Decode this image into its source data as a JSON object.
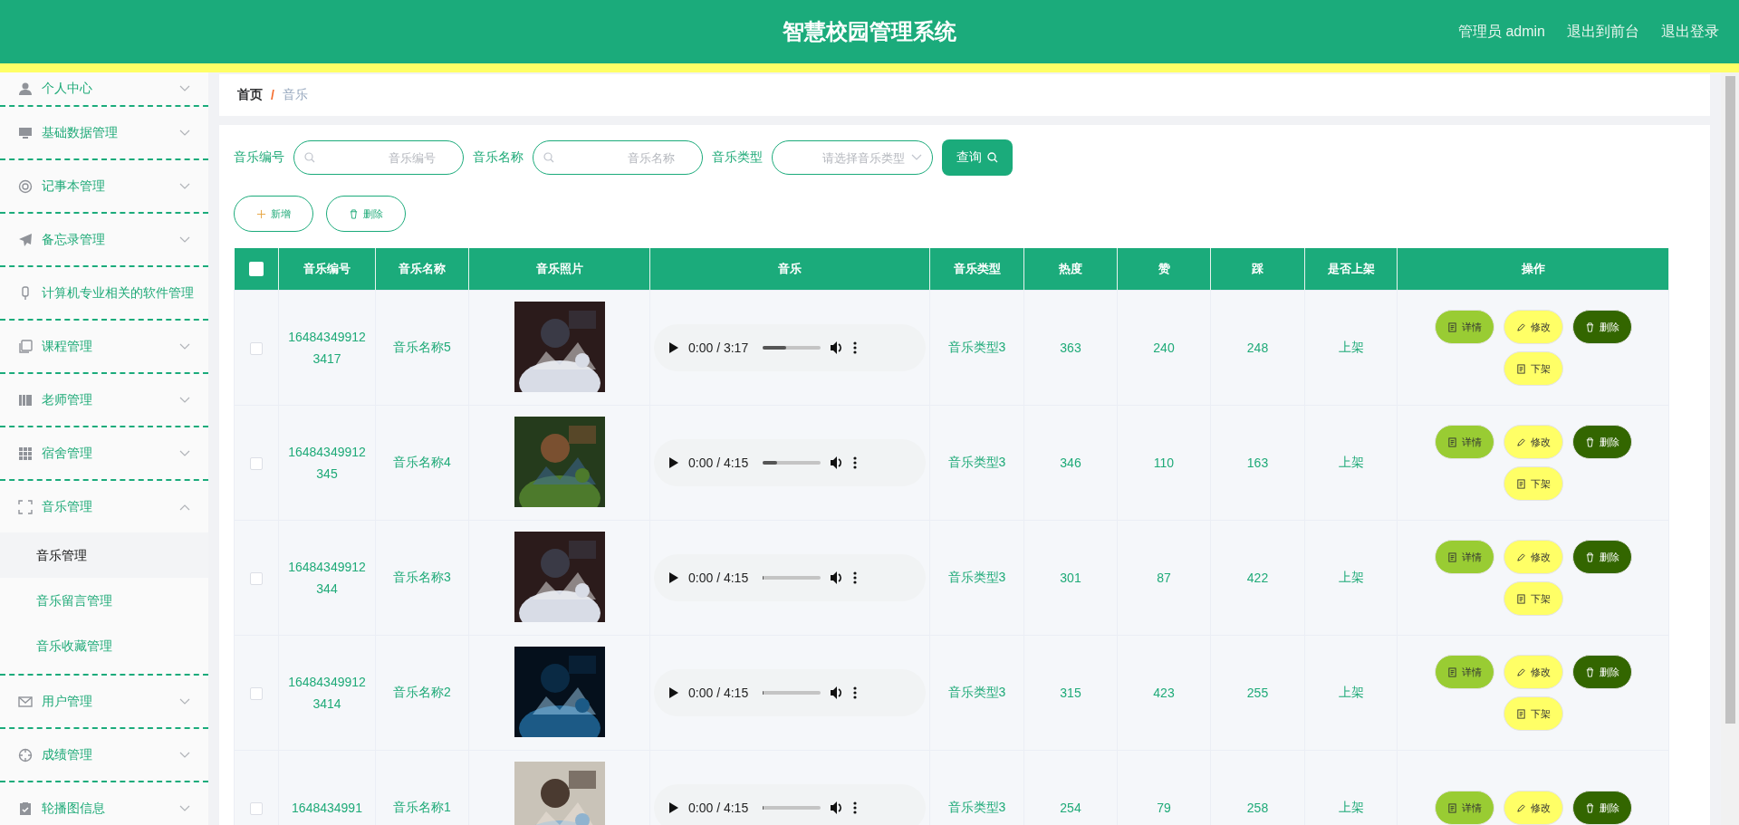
{
  "header": {
    "title": "智慧校园管理系统",
    "links": [
      "管理员 admin",
      "退出到前台",
      "退出登录"
    ]
  },
  "sidebar": {
    "items": [
      {
        "label": "个人中心",
        "expanded": false
      },
      {
        "label": "基础数据管理",
        "expanded": false
      },
      {
        "label": "记事本管理",
        "expanded": false
      },
      {
        "label": "备忘录管理",
        "expanded": false
      },
      {
        "label": "计算机专业相关的软件管理"
      },
      {
        "label": "课程管理",
        "expanded": false
      },
      {
        "label": "老师管理",
        "expanded": false
      },
      {
        "label": "宿舍管理",
        "expanded": false
      },
      {
        "label": "音乐管理",
        "expanded": true,
        "children": [
          {
            "label": "音乐管理",
            "selected": true
          },
          {
            "label": "音乐留言管理",
            "selected": false
          },
          {
            "label": "音乐收藏管理",
            "selected": false
          }
        ]
      },
      {
        "label": "用户管理",
        "expanded": false
      },
      {
        "label": "成绩管理",
        "expanded": false
      },
      {
        "label": "轮播图信息",
        "expanded": false
      }
    ]
  },
  "breadcrumb": {
    "items": [
      "首页",
      "音乐"
    ],
    "separator": "/"
  },
  "search": {
    "fields": [
      {
        "label": "音乐编号",
        "placeholder": "音乐编号",
        "kind": "text"
      },
      {
        "label": "音乐名称",
        "placeholder": "音乐名称",
        "kind": "text"
      },
      {
        "label": "音乐类型",
        "placeholder": "请选择音乐类型",
        "kind": "select"
      }
    ],
    "button": "查询"
  },
  "actions": [
    {
      "label": "新增",
      "kind": "add"
    },
    {
      "label": "删除",
      "kind": "delete"
    }
  ],
  "table": {
    "select_all": {
      "checked": false
    },
    "columns": [
      "音乐编号",
      "音乐名称",
      "音乐照片",
      "音乐",
      "音乐类型",
      "热度",
      "赞",
      "踩",
      "是否上架",
      "操作"
    ],
    "rows": [
      {
        "checked": false,
        "id": "164843499123417",
        "name": "音乐名称5",
        "photo": {
          "kind": "picture"
        },
        "audio": {
          "time": "0:00 / 3:17",
          "level": 0.4
        },
        "type": "音乐类型3",
        "heat": "363",
        "likes": "240",
        "dislikes": "248",
        "status": "上架",
        "buttons": [
          {
            "label": "详情",
            "kind": "detail"
          },
          {
            "label": "修改",
            "kind": "edit"
          },
          {
            "label": "删除",
            "kind": "delete"
          },
          {
            "label": "下架",
            "kind": "off"
          }
        ]
      },
      {
        "checked": false,
        "id": "16484349912345",
        "name": "音乐名称4",
        "photo": {
          "kind": "picture"
        },
        "audio": {
          "time": "0:00 / 4:15",
          "level": 0.25
        },
        "type": "音乐类型3",
        "heat": "346",
        "likes": "110",
        "dislikes": "163",
        "status": "上架",
        "buttons": [
          {
            "label": "详情",
            "kind": "detail"
          },
          {
            "label": "修改",
            "kind": "edit"
          },
          {
            "label": "删除",
            "kind": "delete"
          },
          {
            "label": "下架",
            "kind": "off"
          }
        ]
      },
      {
        "checked": false,
        "id": "16484349912344",
        "name": "音乐名称3",
        "photo": {
          "kind": "picture"
        },
        "audio": {
          "time": "0:00 / 4:15",
          "level": 0
        },
        "type": "音乐类型3",
        "heat": "301",
        "likes": "87",
        "dislikes": "422",
        "status": "上架",
        "buttons": [
          {
            "label": "详情",
            "kind": "detail"
          },
          {
            "label": "修改",
            "kind": "edit"
          },
          {
            "label": "删除",
            "kind": "delete"
          },
          {
            "label": "下架",
            "kind": "off"
          }
        ]
      },
      {
        "checked": false,
        "id": "164843499123414",
        "name": "音乐名称2",
        "photo": {
          "kind": "picture"
        },
        "audio": {
          "time": "0:00 / 4:15",
          "level": 0
        },
        "type": "音乐类型3",
        "heat": "315",
        "likes": "423",
        "dislikes": "255",
        "status": "上架",
        "buttons": [
          {
            "label": "详情",
            "kind": "detail"
          },
          {
            "label": "修改",
            "kind": "edit"
          },
          {
            "label": "删除",
            "kind": "delete"
          },
          {
            "label": "下架",
            "kind": "off"
          }
        ]
      },
      {
        "checked": false,
        "id": "1648434991",
        "name": "音乐名称1",
        "photo": {
          "kind": "picture"
        },
        "audio": {
          "time": "0:00 / 4:15",
          "level": 0
        },
        "type": "音乐类型3",
        "heat": "254",
        "likes": "79",
        "dislikes": "258",
        "status": "上架",
        "buttons": [
          {
            "label": "详情",
            "kind": "detail"
          },
          {
            "label": "修改",
            "kind": "edit"
          },
          {
            "label": "删除",
            "kind": "delete"
          }
        ]
      }
    ]
  }
}
